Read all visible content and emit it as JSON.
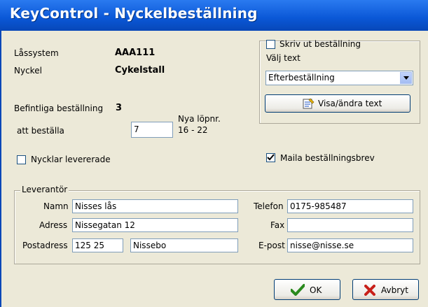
{
  "window": {
    "title": "KeyControl - Nyckelbeställning"
  },
  "info": {
    "lassystem_label": "Låssystem",
    "lassystem_value": "AAA111",
    "nyckel_label": "Nyckel",
    "nyckel_value": "Cykelstall",
    "befintliga_label": "Befintliga beställning",
    "befintliga_value": "3",
    "att_bestalla_label": "att beställa",
    "att_bestalla_value": "7",
    "nya_lopnr_label": "Nya löpnr.",
    "nya_lopnr_value": "16 - 22"
  },
  "print_group": {
    "checkbox_label": "Skriv ut beställning",
    "checked": false,
    "valj_text_label": "Välj text",
    "selected_text": "Efterbeställning",
    "visa_button_label": "Visa/ändra text"
  },
  "nycklar_levererade": {
    "label": "Nycklar levererade",
    "checked": false
  },
  "maila": {
    "label": "Maila beställningsbrev",
    "checked": true
  },
  "leverantor": {
    "legend": "Leverantör",
    "namn_label": "Namn",
    "namn_value": "Nisses lås",
    "adress_label": "Adress",
    "adress_value": "Nissegatan 12",
    "postadress_label": "Postadress",
    "postnummer_value": "125 25",
    "ort_value": "Nissebo",
    "telefon_label": "Telefon",
    "telefon_value": "0175-985487",
    "fax_label": "Fax",
    "fax_value": "",
    "epost_label": "E-post",
    "epost_value": "nisse@nisse.se"
  },
  "buttons": {
    "ok_label": "OK",
    "cancel_label": "Avbryt"
  },
  "icons": {
    "ok": "checkmark-icon",
    "cancel": "x-icon",
    "visa": "edit-text-icon",
    "dropdown": "chevron-down-icon"
  },
  "colors": {
    "titlebar": "#0a57d6",
    "window_bg": "#ece9d8",
    "ok_check": "#2a8a1e",
    "cancel_x": "#c8201a"
  }
}
